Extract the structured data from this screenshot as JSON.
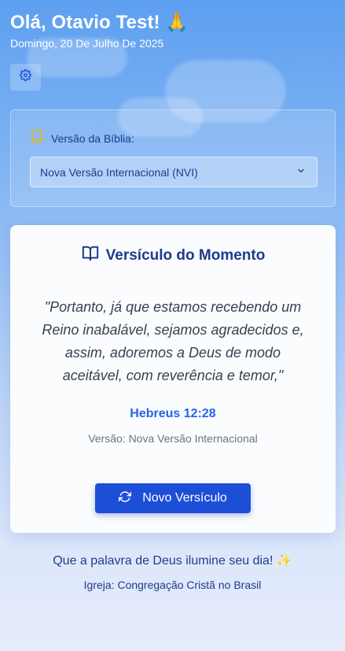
{
  "header": {
    "greeting": "Olá, Otavio Test! 🙏",
    "date": "Domingo, 20 De Julho De 2025"
  },
  "settings": {
    "icon": "gear-icon"
  },
  "bible_selector": {
    "label": "Versão da Bíblia:",
    "icon": "book-icon",
    "selected_value": "Nova Versão Internacional (NVI)"
  },
  "verse_card": {
    "title": "Versículo do Momento",
    "title_icon": "open-book-icon",
    "text": "\"Portanto, já que estamos recebendo um Reino inabalável, sejamos agradecidos e, assim, adoremos a Deus de modo aceitável, com reverência e temor,\"",
    "reference": "Hebreus 12:28",
    "version_label": "Versão: Nova Versão Internacional",
    "button_label": "Novo Versículo",
    "button_icon": "refresh-icon"
  },
  "footer": {
    "message": "Que a palavra de Deus ilumine seu dia! ✨",
    "church": "Igreja: Congregação Cristã no Brasil"
  },
  "colors": {
    "primary": "#1d4ed8",
    "title": "#1e3a8a",
    "reference": "#2563eb",
    "book_icon": "#eab308"
  }
}
